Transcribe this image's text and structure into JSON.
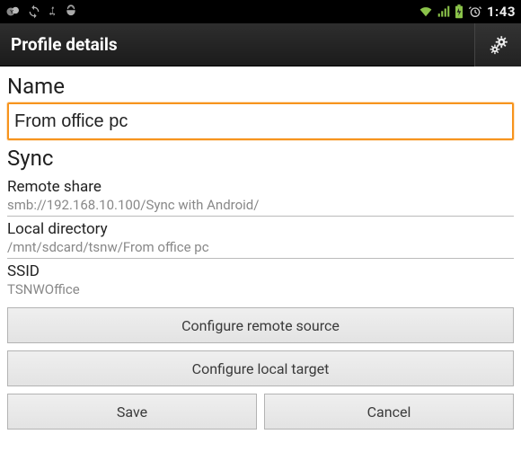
{
  "status": {
    "clock": "1:43"
  },
  "actionbar": {
    "title": "Profile details"
  },
  "sections": {
    "name_title": "Name",
    "sync_title": "Sync"
  },
  "name": {
    "value": "From office pc"
  },
  "fields": {
    "remote_share": {
      "label": "Remote share",
      "value": "smb://192.168.10.100/Sync with Android/"
    },
    "local_dir": {
      "label": "Local directory",
      "value": "/mnt/sdcard/tsnw/From office pc"
    },
    "ssid": {
      "label": "SSID",
      "value": "TSNWOffice"
    }
  },
  "buttons": {
    "configure_remote": "Configure remote source",
    "configure_local": "Configure local target",
    "save": "Save",
    "cancel": "Cancel"
  }
}
